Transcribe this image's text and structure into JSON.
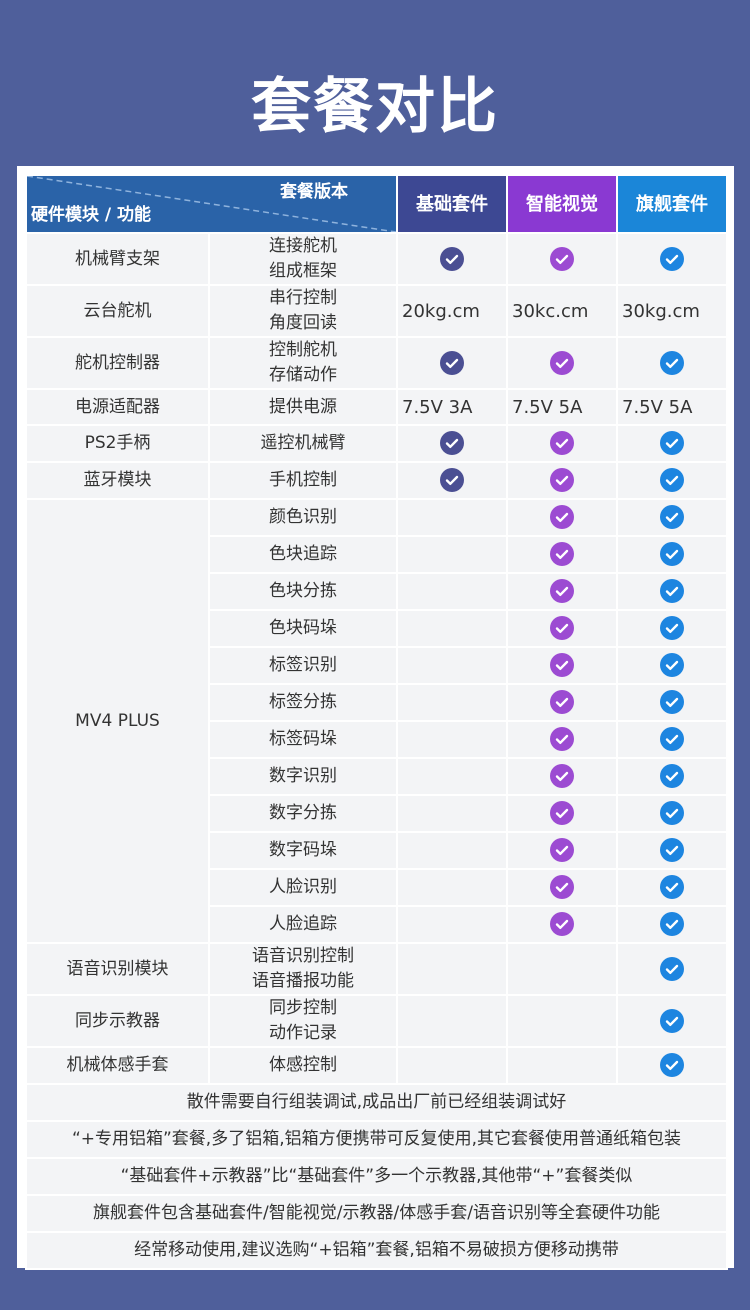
{
  "title": "套餐对比",
  "header": {
    "version_label": "套餐版本",
    "module_label": "硬件模块 / 功能",
    "plans": [
      "基础套件",
      "智能视觉",
      "旗舰套件"
    ]
  },
  "colors": {
    "basic": "#4b4f93",
    "vision": "#9c4bd2",
    "flagship": "#1d85e0"
  },
  "rows": [
    {
      "module": "机械臂支架",
      "feature": "连接舵机\n组成框架",
      "basic": "check",
      "vision": "check",
      "flagship": "check"
    },
    {
      "module": "云台舵机",
      "feature": "串行控制\n角度回读",
      "basic": "20kg.cm",
      "vision": "30kc.cm",
      "flagship": "30kg.cm"
    },
    {
      "module": "舵机控制器",
      "feature": "控制舵机\n存储动作",
      "basic": "check",
      "vision": "check",
      "flagship": "check"
    },
    {
      "module": "电源适配器",
      "feature": "提供电源",
      "basic": "7.5V 3A",
      "vision": "7.5V 5A",
      "flagship": "7.5V 5A"
    },
    {
      "module": "PS2手柄",
      "feature": "遥控机械臂",
      "basic": "check",
      "vision": "check",
      "flagship": "check"
    },
    {
      "module": "蓝牙模块",
      "feature": "手机控制",
      "basic": "check",
      "vision": "check",
      "flagship": "check"
    },
    {
      "module": "MV4 PLUS",
      "feature": "颜色识别",
      "basic": "",
      "vision": "check",
      "flagship": "check"
    },
    {
      "module": "",
      "feature": "色块追踪",
      "basic": "",
      "vision": "check",
      "flagship": "check"
    },
    {
      "module": "",
      "feature": "色块分拣",
      "basic": "",
      "vision": "check",
      "flagship": "check"
    },
    {
      "module": "",
      "feature": "色块码垛",
      "basic": "",
      "vision": "check",
      "flagship": "check"
    },
    {
      "module": "",
      "feature": "标签识别",
      "basic": "",
      "vision": "check",
      "flagship": "check"
    },
    {
      "module": "",
      "feature": "标签分拣",
      "basic": "",
      "vision": "check",
      "flagship": "check"
    },
    {
      "module": "",
      "feature": "标签码垛",
      "basic": "",
      "vision": "check",
      "flagship": "check"
    },
    {
      "module": "",
      "feature": "数字识别",
      "basic": "",
      "vision": "check",
      "flagship": "check"
    },
    {
      "module": "",
      "feature": "数字分拣",
      "basic": "",
      "vision": "check",
      "flagship": "check"
    },
    {
      "module": "",
      "feature": "数字码垛",
      "basic": "",
      "vision": "check",
      "flagship": "check"
    },
    {
      "module": "",
      "feature": "人脸识别",
      "basic": "",
      "vision": "check",
      "flagship": "check"
    },
    {
      "module": "",
      "feature": "人脸追踪",
      "basic": "",
      "vision": "check",
      "flagship": "check"
    },
    {
      "module": "语音识别模块",
      "feature": "语音识别控制\n语音播报功能",
      "basic": "",
      "vision": "",
      "flagship": "check"
    },
    {
      "module": "同步示教器",
      "feature": "同步控制\n动作记录",
      "basic": "",
      "vision": "",
      "flagship": "check"
    },
    {
      "module": "机械体感手套",
      "feature": "体感控制",
      "basic": "",
      "vision": "",
      "flagship": "check"
    }
  ],
  "notes": [
    "散件需要自行组装调试,成品出厂前已经组装调试好",
    "“+专用铝箱”套餐,多了铝箱,铝箱方便携带可反复使用,其它套餐使用普通纸箱包装",
    "“基础套件+示教器”比“基础套件”多一个示教器,其他带“+”套餐类似",
    "旗舰套件包含基础套件/智能视觉/示教器/体感手套/语音识别等全套硬件功能",
    "经常移动使用,建议选购“+铝箱”套餐,铝箱不易破损方便移动携带"
  ]
}
